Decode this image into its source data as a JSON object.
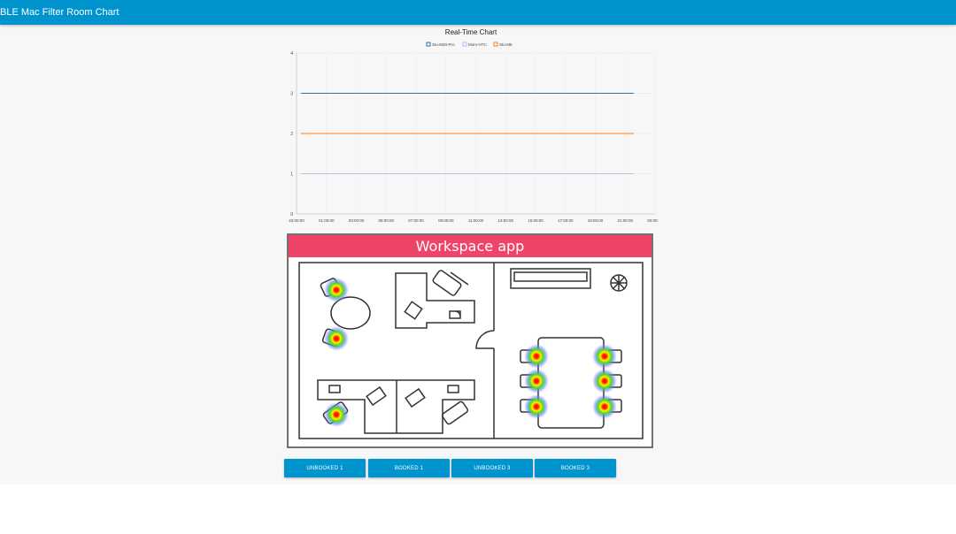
{
  "toolbar": {
    "title": "BLE Mac Filter Room Chart"
  },
  "chart_data": {
    "type": "line",
    "title": "Real-Time Chart",
    "xlabel": "",
    "ylabel": "",
    "legend_position": "top",
    "grid": true,
    "ylim": [
      0,
      4
    ],
    "yticks": [
      "0",
      "1",
      "2",
      "3",
      "4"
    ],
    "xticks": [
      "23:00:00",
      "01:00:00",
      "03:00:00",
      "05:00:00",
      "07:00:00",
      "09:00:00",
      "11:00:00",
      "13:00:00",
      "15:00:00",
      "17:00:00",
      "19:00:00",
      "21:00:00",
      "00:00:00"
    ],
    "series": [
      {
        "name": "Stu-M20-Pro",
        "color": "#1f77b4",
        "values": [
          3,
          3
        ]
      },
      {
        "name": "Mom-HTC",
        "color": "#aec7e8",
        "values": [
          1,
          1
        ]
      },
      {
        "name": "Stu-M8",
        "color": "#ff7f0e",
        "values": [
          2,
          2
        ]
      }
    ]
  },
  "floorplan": {
    "header": "Workspace app",
    "header_color": "#f0436a"
  },
  "buttons": {
    "unbooked1": "UNBOOKED 1",
    "booked1": "BOOKED 1",
    "unbooked3": "UNBOOKED 3",
    "booked3": "BOOKED 3"
  }
}
